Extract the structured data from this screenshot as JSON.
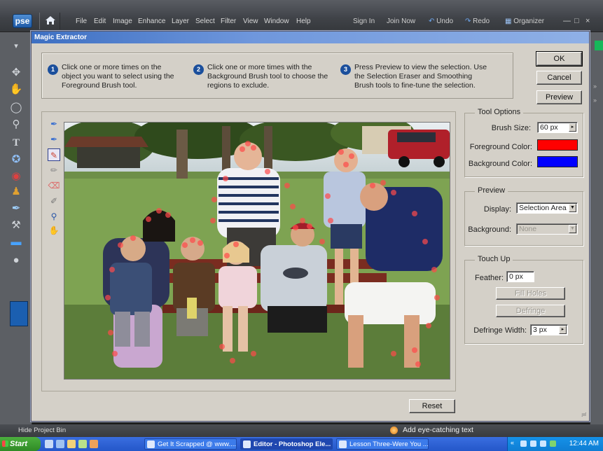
{
  "app": {
    "logo_text": "pse",
    "menu": [
      "File",
      "Edit",
      "Image",
      "Enhance",
      "Layer",
      "Select",
      "Filter",
      "View",
      "Window",
      "Help"
    ],
    "sign_in": "Sign In",
    "join_now": "Join Now",
    "undo": "Undo",
    "redo": "Redo",
    "organizer": "Organizer"
  },
  "dialog": {
    "title": "Magic Extractor",
    "steps": [
      {
        "num": "1",
        "text": "Click one or more times on the object you want to select using the Foreground Brush tool."
      },
      {
        "num": "2",
        "text": "Click one or more times with the Background Brush tool to choose the regions to exclude."
      },
      {
        "num": "3",
        "text": "Press Preview to view the selection. Use the Selection Eraser and Smoothing Brush tools to fine-tune the selection."
      }
    ],
    "buttons": {
      "ok": "OK",
      "cancel": "Cancel",
      "preview": "Preview",
      "reset": "Reset"
    },
    "tool_options": {
      "title": "Tool Options",
      "brush_size_label": "Brush Size:",
      "brush_size_value": "60 px",
      "foreground_label": "Foreground Color:",
      "foreground_color": "#ff0000",
      "background_label": "Background Color:",
      "background_color": "#0000ff"
    },
    "preview": {
      "title": "Preview",
      "display_label": "Display:",
      "display_value": "Selection Area",
      "background_label": "Background:",
      "background_value": "None"
    },
    "touch_up": {
      "title": "Touch Up",
      "feather_label": "Feather:",
      "feather_value": "0 px",
      "fill_holes": "Fill Holes",
      "defringe": "Defringe",
      "defringe_width_label": "Defringe Width:",
      "defringe_width_value": "3 px"
    }
  },
  "bin": {
    "hide_label": "Hide Project Bin",
    "tip": "Add eye-catching text"
  },
  "taskbar": {
    "start": "Start",
    "tasks": [
      {
        "label": "Get It Scrapped @ www....",
        "active": false
      },
      {
        "label": "Editor - Photoshop Ele...",
        "active": true
      },
      {
        "label": "Lesson Three-Were You ...",
        "active": false
      }
    ],
    "clock": "12:44 AM"
  }
}
